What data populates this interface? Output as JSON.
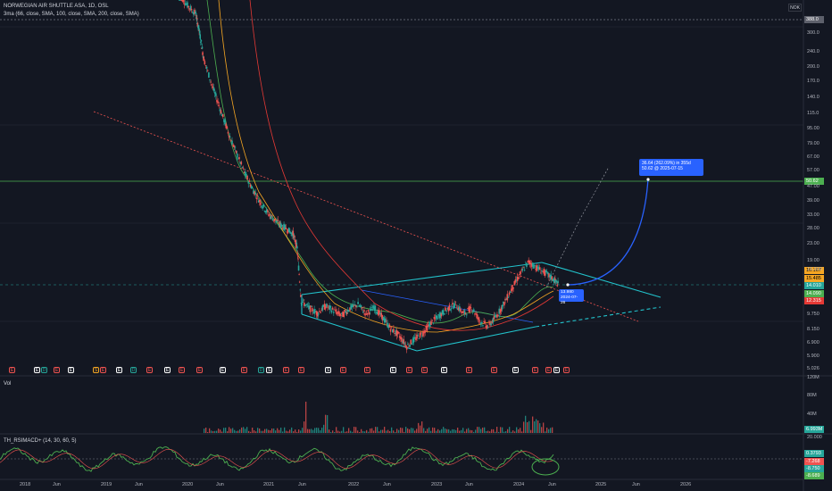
{
  "header": {
    "title": "NORWEGIAN AIR SHUTTLE ASA, 1D, OSL",
    "indicator_ma": "3ma (66, close, SMA, 100, close, SMA, 200, close, SMA)",
    "vol_label": "Vol",
    "rsimacd_label": "TH_RSIMACD+ (14, 30, 60, 5)",
    "currency": "NOK"
  },
  "colors": {
    "bg": "#131722",
    "up": "#26a69a",
    "down": "#ef5350",
    "ma66": "#4caf50",
    "ma100": "#f5a623",
    "ma200": "#e53935",
    "channel": "#22c3cc",
    "projection": "#2962ff",
    "resistance": "#4caf50"
  },
  "chart_data": [
    {
      "type": "line",
      "title": "NORWEGIAN AIR SHUTTLE ASA, 1D, OSL",
      "y_scale": "log",
      "y_ticks": [
        "300.0",
        "240.0",
        "200.0",
        "170.0",
        "140.0",
        "115.0",
        "95.00",
        "79.00",
        "67.00",
        "57.00",
        "47.00",
        "39.00",
        "33.00",
        "28.00",
        "23.00",
        "19.00",
        "16.000",
        "9.750",
        "8.150",
        "6.900",
        "5.900",
        "5.026"
      ],
      "x_ticks": [
        "2018",
        "Jun",
        "2019",
        "Jun",
        "2020",
        "Jun",
        "2021",
        "Jun",
        "2022",
        "Jun",
        "2023",
        "Jun",
        "2024",
        "Jun",
        "2025",
        "Jun",
        "2026"
      ],
      "price_levels": {
        "top_badge": "388.0",
        "resistance": "50.62",
        "p1": "16.167",
        "p2": "15.485",
        "last": "14.010",
        "p3": "14.090",
        "p4": "12.315"
      },
      "projection_callout": {
        "line1": "36.64 (262.09%) in 355d",
        "line2": "50.62 @ 2025-07-15"
      },
      "current_callout": {
        "line1": "13.980",
        "line2": "2024-07-26"
      },
      "price_series": {
        "x": [
          2019.9,
          2020.0,
          2020.1,
          2020.15,
          2020.2,
          2020.3,
          2020.4,
          2020.5,
          2020.6,
          2020.7,
          2020.8,
          2020.9,
          2021.0,
          2021.1,
          2021.2,
          2021.3,
          2021.35,
          2021.4,
          2021.5,
          2021.6,
          2021.7,
          2021.8,
          2021.9,
          2022.0,
          2022.1,
          2022.2,
          2022.3,
          2022.4,
          2022.5,
          2022.6,
          2022.7,
          2022.8,
          2022.9,
          2023.0,
          2023.1,
          2023.2,
          2023.3,
          2023.4,
          2023.5,
          2023.6,
          2023.7,
          2023.8,
          2023.9,
          2024.0,
          2024.1,
          2024.2,
          2024.3,
          2024.4,
          2024.5,
          2024.57
        ],
        "y": [
          480,
          420,
          380,
          300,
          220,
          160,
          120,
          90,
          70,
          55,
          45,
          38,
          33,
          30,
          28,
          26,
          22,
          11.5,
          10.5,
          9.9,
          10.8,
          10.2,
          9.6,
          10.5,
          11.0,
          9.8,
          10.6,
          9.4,
          8.2,
          7.6,
          6.6,
          7.2,
          7.8,
          8.8,
          9.6,
          10.4,
          11.0,
          9.8,
          10.6,
          9.0,
          8.4,
          9.5,
          11.2,
          13.5,
          16.0,
          18.5,
          17.2,
          16.2,
          15.0,
          13.98
        ]
      },
      "volume_ticks": [
        "120M",
        "80M",
        "40M"
      ],
      "volume_last": "6.993M",
      "rsimacd_ticks": [
        "20.000"
      ],
      "rsimacd_values": [
        "0.3793",
        "-7.268",
        "-8.750",
        "-8.689"
      ]
    }
  ],
  "events": [
    "E",
    "E",
    "D",
    "E",
    "E",
    "S",
    "E",
    "E",
    "D",
    "E",
    "E",
    "E",
    "E",
    "E",
    "E",
    "D",
    "S",
    "E",
    "E",
    "S",
    "E",
    "E",
    "E",
    "E",
    "E",
    "E",
    "E",
    "E",
    "E",
    "E",
    "E",
    "E",
    "E"
  ]
}
